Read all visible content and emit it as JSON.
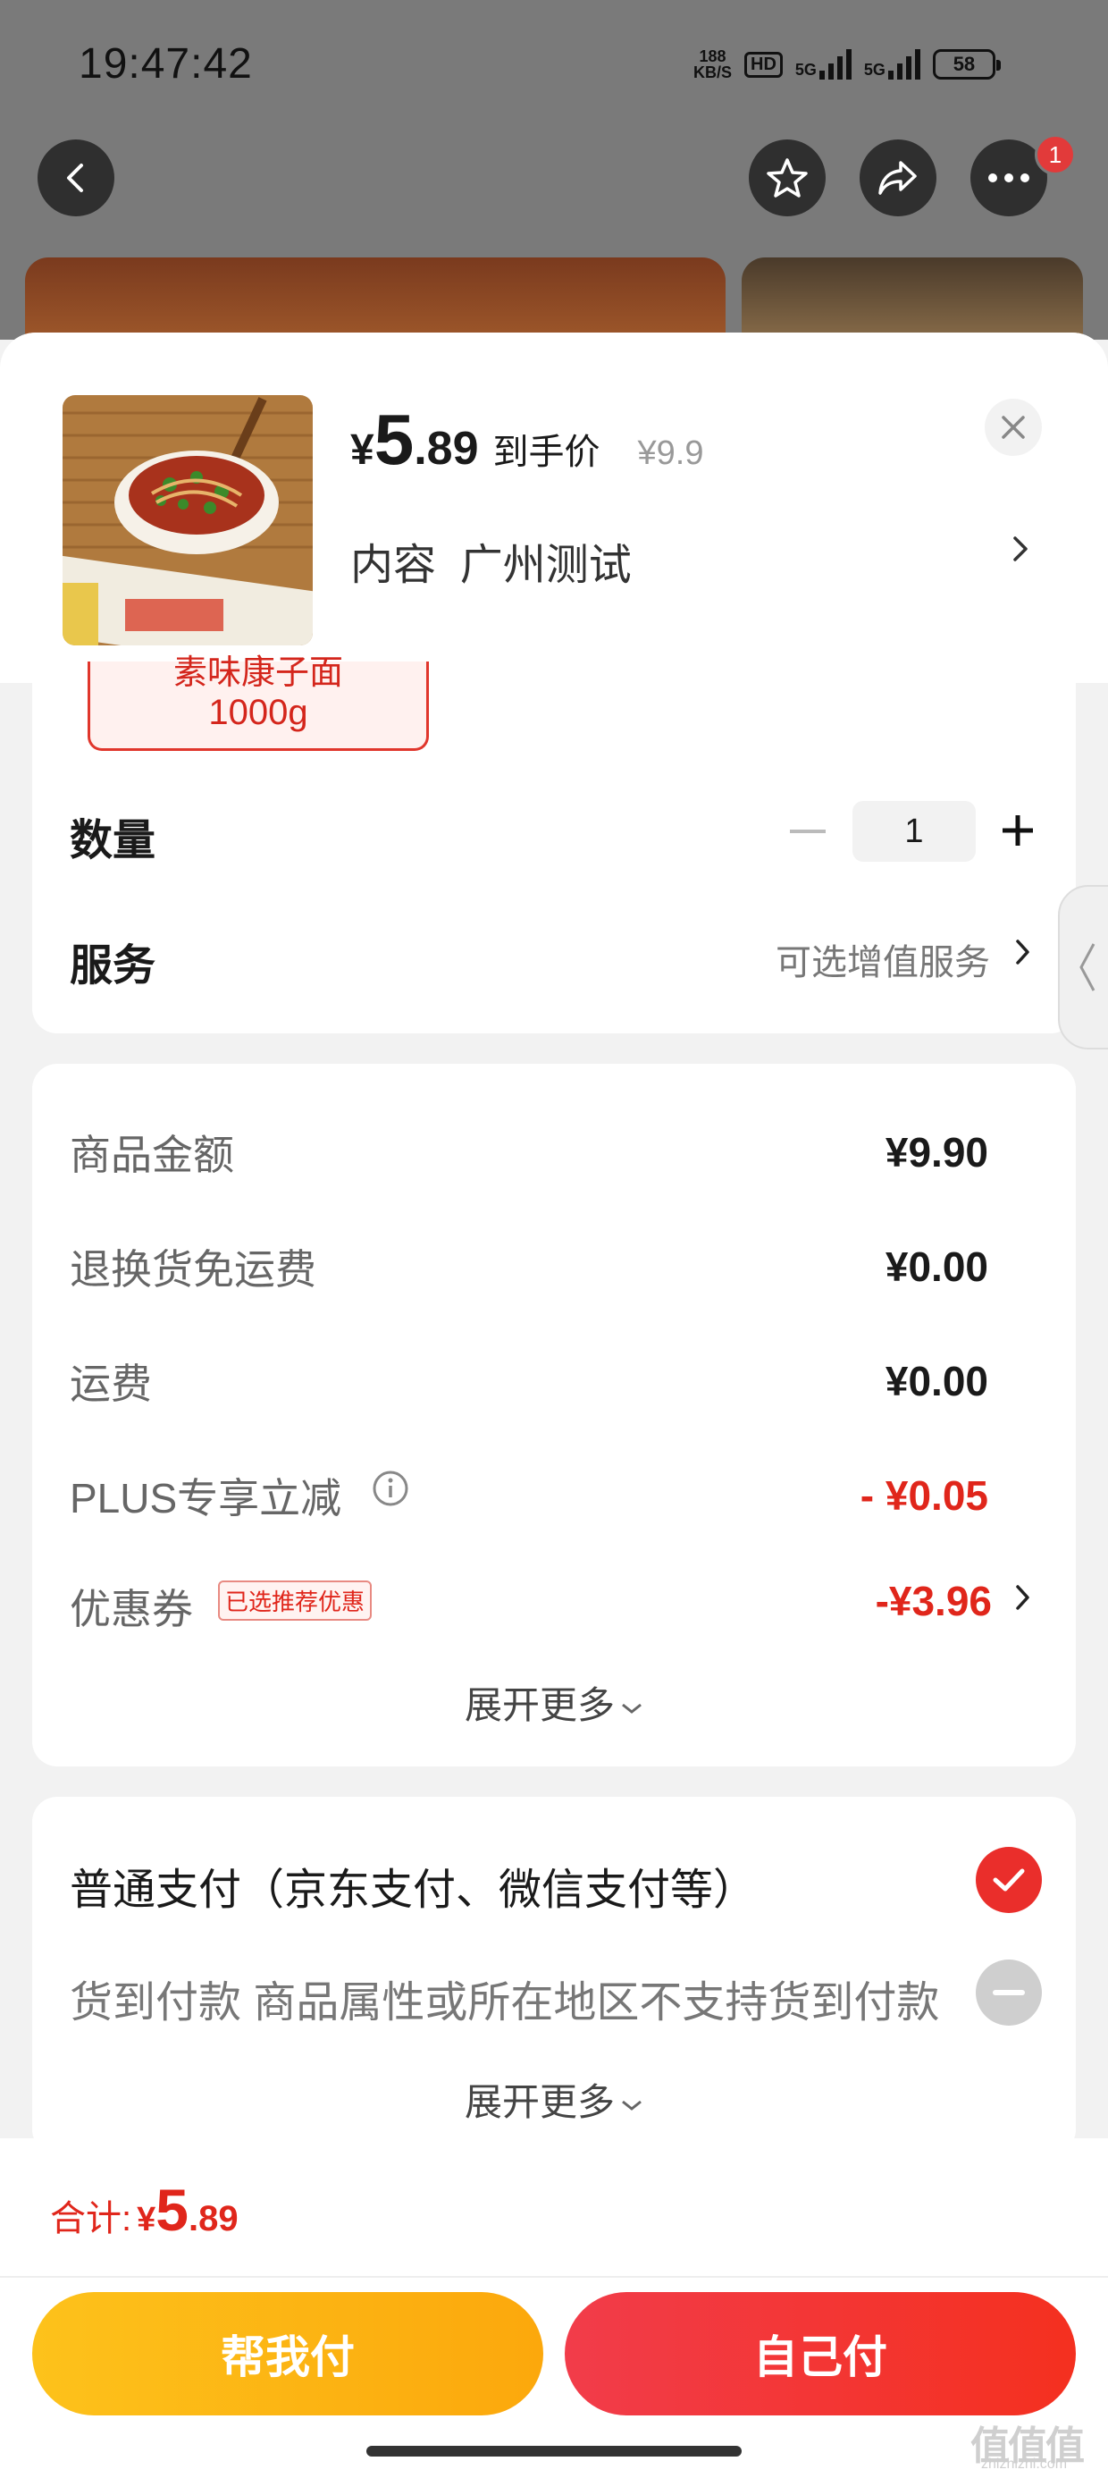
{
  "status_bar": {
    "time": "19:47:42",
    "net_speed_top": "188",
    "net_speed_bottom": "KB/S",
    "hd": "HD",
    "sim1": "5G",
    "sim2": "5G",
    "battery": "58"
  },
  "top_nav": {
    "back_icon": "chevron-left-icon",
    "star_icon": "star-icon",
    "share_icon": "share-icon",
    "more_icon": "more-icon",
    "more_badge": "1"
  },
  "product": {
    "currency": "¥",
    "price_int": "5",
    "price_dec": ".89",
    "price_label": "到手价",
    "original_price": "¥9.9",
    "spec_label": "内容",
    "spec_value": "广州测试",
    "variant_line1": "素味康子面",
    "variant_line2": "1000g"
  },
  "quantity": {
    "label": "数量",
    "value": "1"
  },
  "service": {
    "label": "服务",
    "value": "可选增值服务"
  },
  "fees": [
    {
      "label": "商品金额",
      "value": "¥9.90"
    },
    {
      "label": "退换货免运费",
      "value": "¥0.00"
    },
    {
      "label": "运费",
      "value": "¥0.00"
    },
    {
      "label": "PLUS专享立减",
      "value": "- ¥0.05"
    },
    {
      "label": "优惠券",
      "value": "-¥3.96"
    }
  ],
  "coupon_tag": "已选推荐优惠",
  "expand_more": "展开更多",
  "payment": {
    "normal": "普通支付（京东支付、微信支付等）",
    "cod": "货到付款 商品属性或所在地区不支持货到付款",
    "expand_more": "展开更多"
  },
  "total": {
    "label": "合计:",
    "currency": "¥",
    "int": "5",
    "dec": ".89"
  },
  "buttons": {
    "friend_pay": "帮我付",
    "self_pay": "自己付"
  },
  "watermark": {
    "main": "值值值",
    "sub": "zhizhizhi.com"
  },
  "colors": {
    "accent_red": "#e0261b",
    "button_yellow": "#fdc21b",
    "button_red": "#f23c4a"
  }
}
